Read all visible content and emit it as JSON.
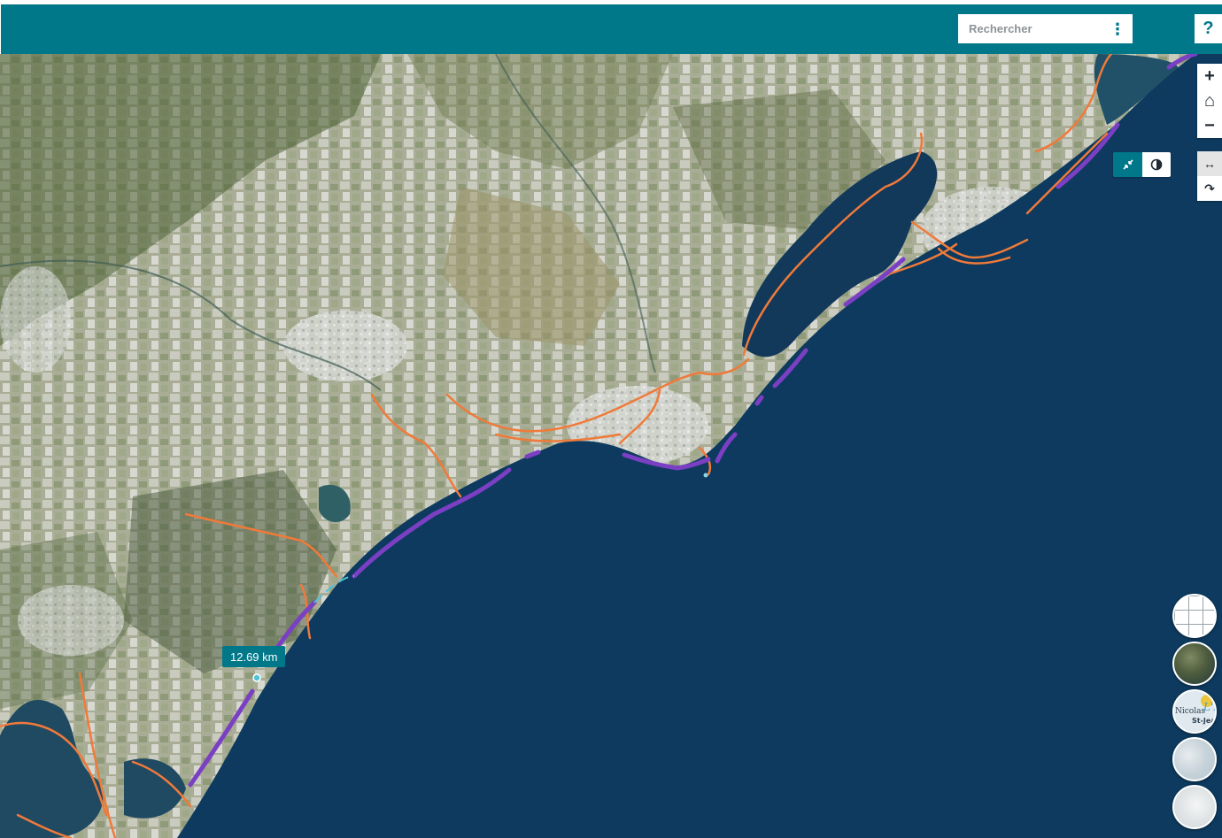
{
  "header": {
    "search_placeholder": "Rechercher",
    "menu_glyph": "⋮",
    "help_label": "?"
  },
  "map_controls": {
    "zoom_in": "+",
    "home": "⌂",
    "zoom_out": "−",
    "resize": "↔",
    "redo": "↷"
  },
  "layer_toggle": {
    "compress_icon": "compress-icon",
    "contrast_icon": "contrast-icon"
  },
  "measurement": {
    "label": "12.69 km"
  },
  "basemaps": {
    "items": [
      {
        "name": "grid-basemap",
        "label": ""
      },
      {
        "name": "satellite-basemap",
        "label": ""
      },
      {
        "name": "plan-basemap",
        "label": "Nicolas L'É St-Jean"
      },
      {
        "name": "relief-basemap",
        "label": ""
      },
      {
        "name": "light-basemap",
        "label": ""
      }
    ]
  },
  "colors": {
    "accent": "#00788a",
    "sea": "#0d3a5e",
    "coastline_route": "#f07a3a",
    "measured_route": "#7b3fc4",
    "measure_line": "#4fc3d8"
  }
}
